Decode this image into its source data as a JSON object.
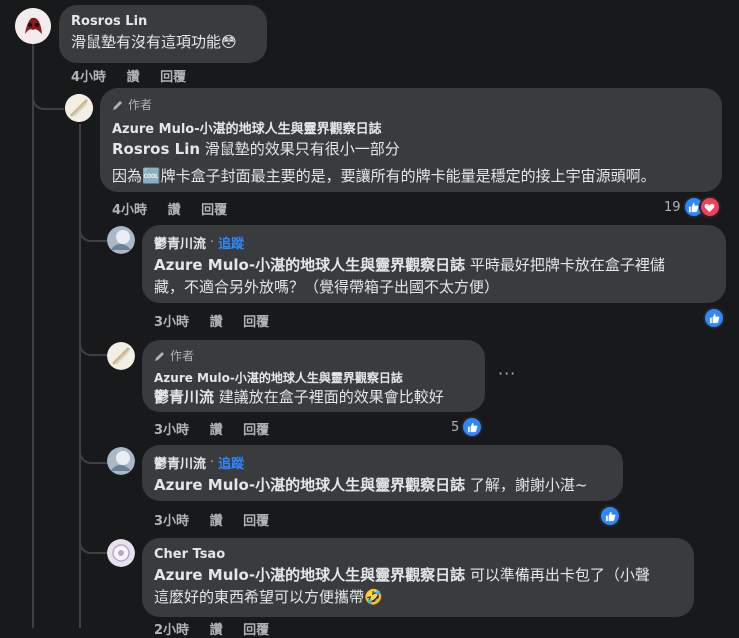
{
  "actions": {
    "like": "讚",
    "reply": "回覆"
  },
  "author_badge": "作者",
  "follow_label": "追蹤",
  "dot": "·",
  "comments": [
    {
      "name": "Rosros Lin",
      "text": "滑鼠墊有沒有這項功能😳",
      "time": "4小時"
    },
    {
      "name": "Azure Mulo-小湛的地球人生與靈界觀察日誌",
      "tag": "Rosros Lin",
      "text": "滑鼠墊的效果只有很小一部分",
      "text2": "因為🆒牌卡盒子封面最主要的是，要讓所有的牌卡能量是穩定的接上宇宙源頭啊。",
      "time": "4小時",
      "reactions": "19"
    },
    {
      "name": "鬱青川流",
      "tag": "Azure Mulo-小湛的地球人生與靈界觀察日誌",
      "text": "平時最好把牌卡放在盒子裡儲",
      "text2": "藏，不適合另外放嗎？（覺得帶箱子出國不太方便）",
      "time": "3小時"
    },
    {
      "name": "Azure Mulo-小湛的地球人生與靈界觀察日誌",
      "tag": "鬱青川流",
      "text": "建議放在盒子裡面的效果會比較好",
      "time": "3小時",
      "reactions": "5"
    },
    {
      "name": "鬱青川流",
      "tag": "Azure Mulo-小湛的地球人生與靈界觀察日誌",
      "text": "了解，謝謝小湛~",
      "time": "3小時"
    },
    {
      "name": "Cher Tsao",
      "tag": "Azure Mulo-小湛的地球人生與靈界觀察日誌",
      "text": "可以準備再出卡包了（小聲",
      "text2": "這麼好的東西希望可以方便攜帶🤣",
      "time": "2小時"
    }
  ],
  "colors": {
    "background": "#18191a",
    "bubble": "#3a3b3c",
    "like": "#2d88ff",
    "love": "#f33e58",
    "follow": "#2d88ff"
  }
}
